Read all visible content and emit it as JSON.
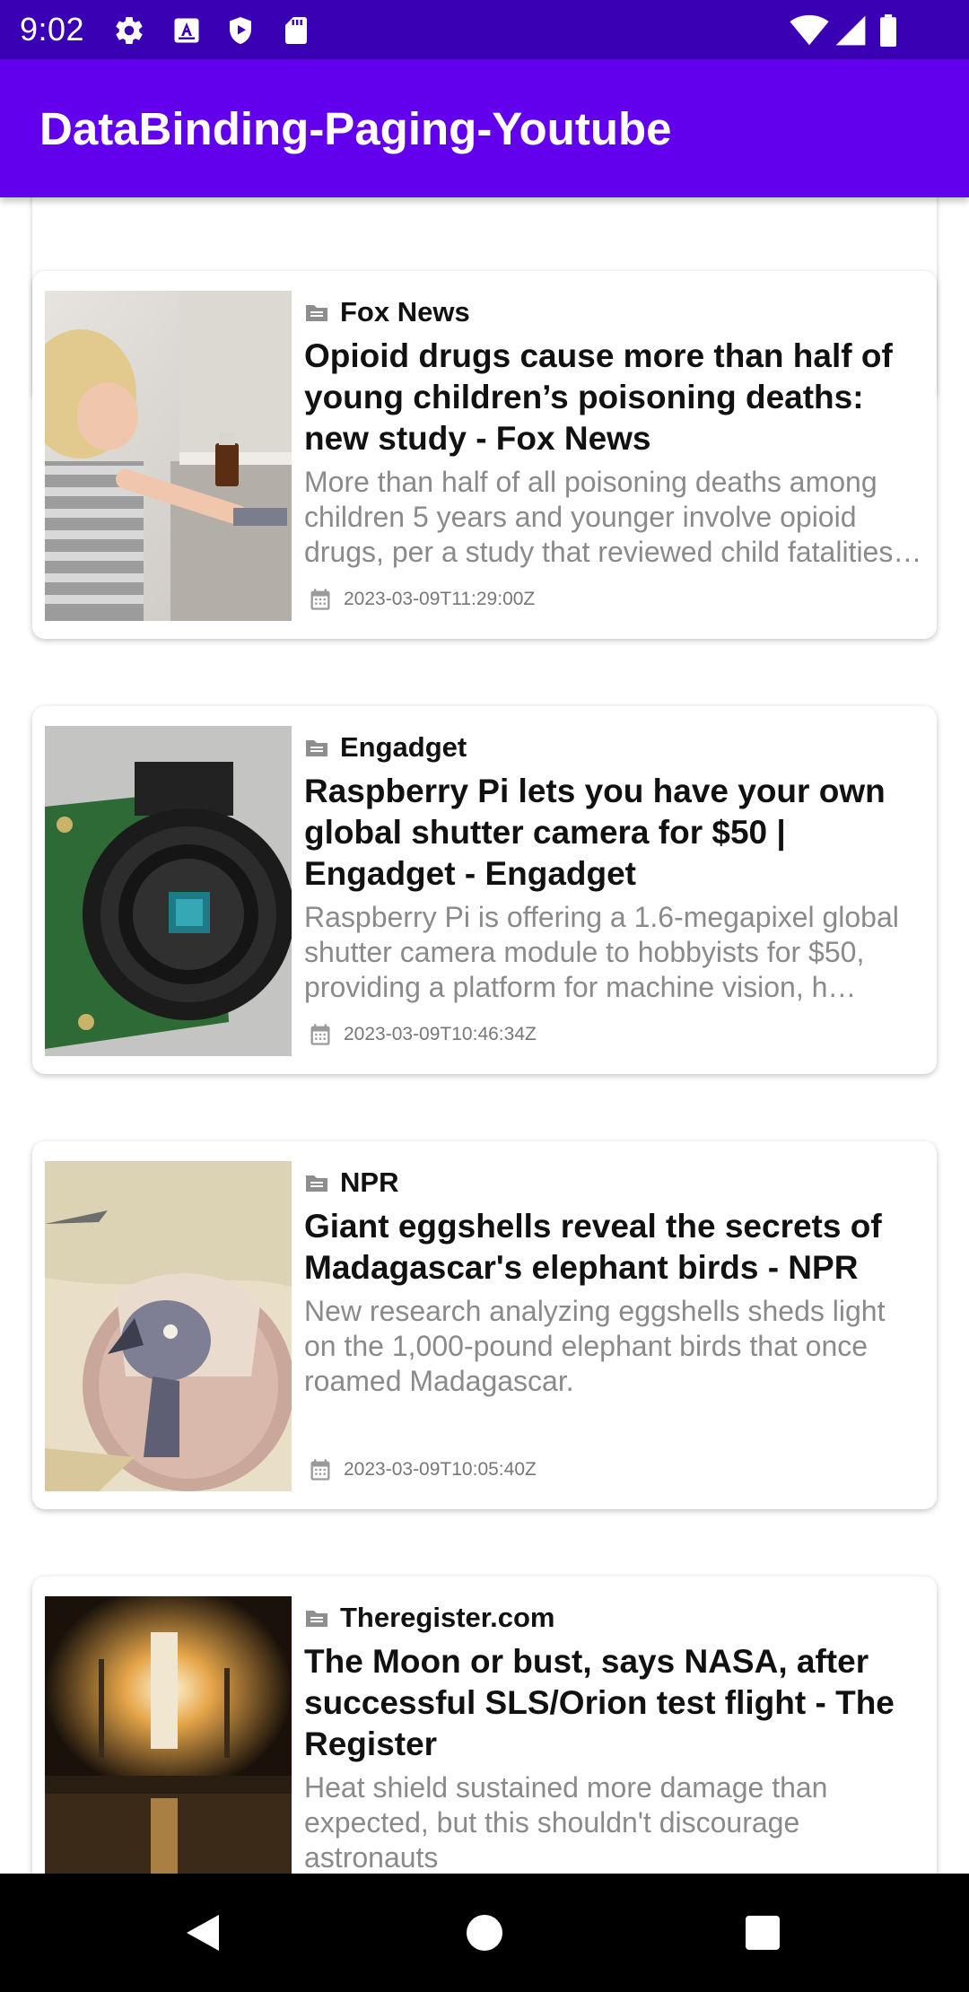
{
  "status_bar": {
    "time": "9:02",
    "icons": [
      "gear-icon",
      "a-badge-icon",
      "shield-play-icon",
      "sd-card-icon",
      "wifi-icon",
      "signal-icon",
      "battery-icon"
    ]
  },
  "app_bar": {
    "title": "DataBinding-Paging-Youtube",
    "color": "#6200ee"
  },
  "articles": [
    {
      "source": "Fox News",
      "title": "Opioid drugs cause more than half of young children’s poisoning deaths: new study - Fox News",
      "description": "More than half of all poisoning deaths among children 5 years and younger involve opioid drugs, per a study that reviewed child fatalities…",
      "date": "2023-03-09T11:29:00Z",
      "thumbnail": "child-with-medicine-bottle"
    },
    {
      "source": "Engadget",
      "title": "Raspberry Pi lets you have your own global shutter camera for $50 | Engadget - Engadget",
      "description": "Raspberry Pi is offering a 1.6-megapixel global shutter camera module to hobbyists for $50, providing a platform for machine vision, h…",
      "date": "2023-03-09T10:46:34Z",
      "thumbnail": "raspberry-pi-camera-module"
    },
    {
      "source": "NPR",
      "title": "Giant eggshells reveal the secrets of Madagascar's elephant birds - NPR",
      "description": "New research analyzing eggshells sheds light on the 1,000-pound elephant birds that once roamed Madagascar.",
      "date": "2023-03-09T10:05:40Z",
      "thumbnail": "bird-hatching-from-egg-illustration"
    },
    {
      "source": "Theregister.com",
      "title": "The Moon or bust, says NASA, after successful SLS/Orion test flight - The Register",
      "description": "Heat shield sustained more damage than expected, but this shouldn't discourage astronauts",
      "date": "",
      "thumbnail": "rocket-launch-at-night"
    }
  ],
  "nav_bar": {
    "buttons": [
      "back-icon",
      "home-icon",
      "recents-icon"
    ]
  }
}
